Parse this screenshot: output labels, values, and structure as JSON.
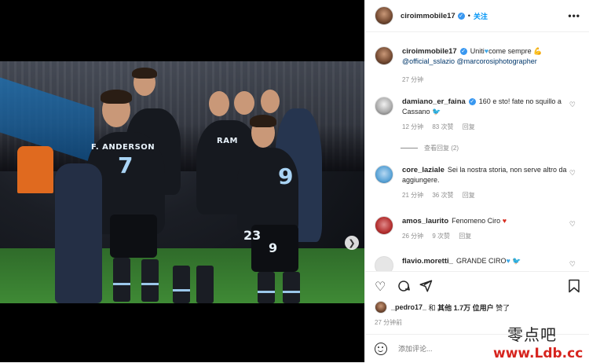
{
  "post": {
    "username": "ciroimmobile17",
    "follow_label": "关注",
    "caption": {
      "text_prefix": "Uniti",
      "text_suffix": "come sempre",
      "mentions": [
        "@official_sslazio",
        "@marcorosiphotographer"
      ],
      "time": "27 分钟"
    }
  },
  "photo": {
    "jersey_left_name": "F. ANDERSON",
    "jersey_left_number": "7",
    "jersey_right_number": "9",
    "jersey_right_short": "9",
    "jersey_back_number": "23",
    "jersey_mid_name": "RAM"
  },
  "comments": [
    {
      "username": "damiano_er_faina",
      "verified": true,
      "text": "160 e sto! fate no squillo a Cassano",
      "time": "12 分钟",
      "likes": "83 次赞",
      "reply": "回复",
      "view_replies": "查看回复 (2)"
    },
    {
      "username": "core_laziale",
      "verified": false,
      "text": "Sei la nostra storia, non serve altro da aggiungere.",
      "time": "21 分钟",
      "likes": "36 次赞",
      "reply": "回复"
    },
    {
      "username": "amos_laurito",
      "verified": false,
      "text": "Fenomeno Ciro",
      "time": "26 分钟",
      "likes": "9 次赞",
      "reply": "回复"
    },
    {
      "username": "flavio.moretti_",
      "verified": false,
      "text": "GRANDE CIRO"
    }
  ],
  "likes_line": {
    "user": "_pedro17_",
    "and": "和",
    "others": "其他 1.7万 位用户",
    "suffix": "赞了"
  },
  "time_ago": "27 分钟前",
  "comment_input": {
    "placeholder": "添加评论..."
  },
  "watermark": {
    "cn": "零点吧",
    "url": "www.Ldb.cc"
  },
  "icons": [
    "heart-icon",
    "comment-icon",
    "share-icon",
    "bookmark-icon",
    "more-icon",
    "smile-icon",
    "next-arrow-icon",
    "verified-icon"
  ],
  "colors": {
    "link": "#00376b",
    "follow": "#0095f6",
    "verified": "#3897f0",
    "watermark_url": "#d6241e"
  }
}
